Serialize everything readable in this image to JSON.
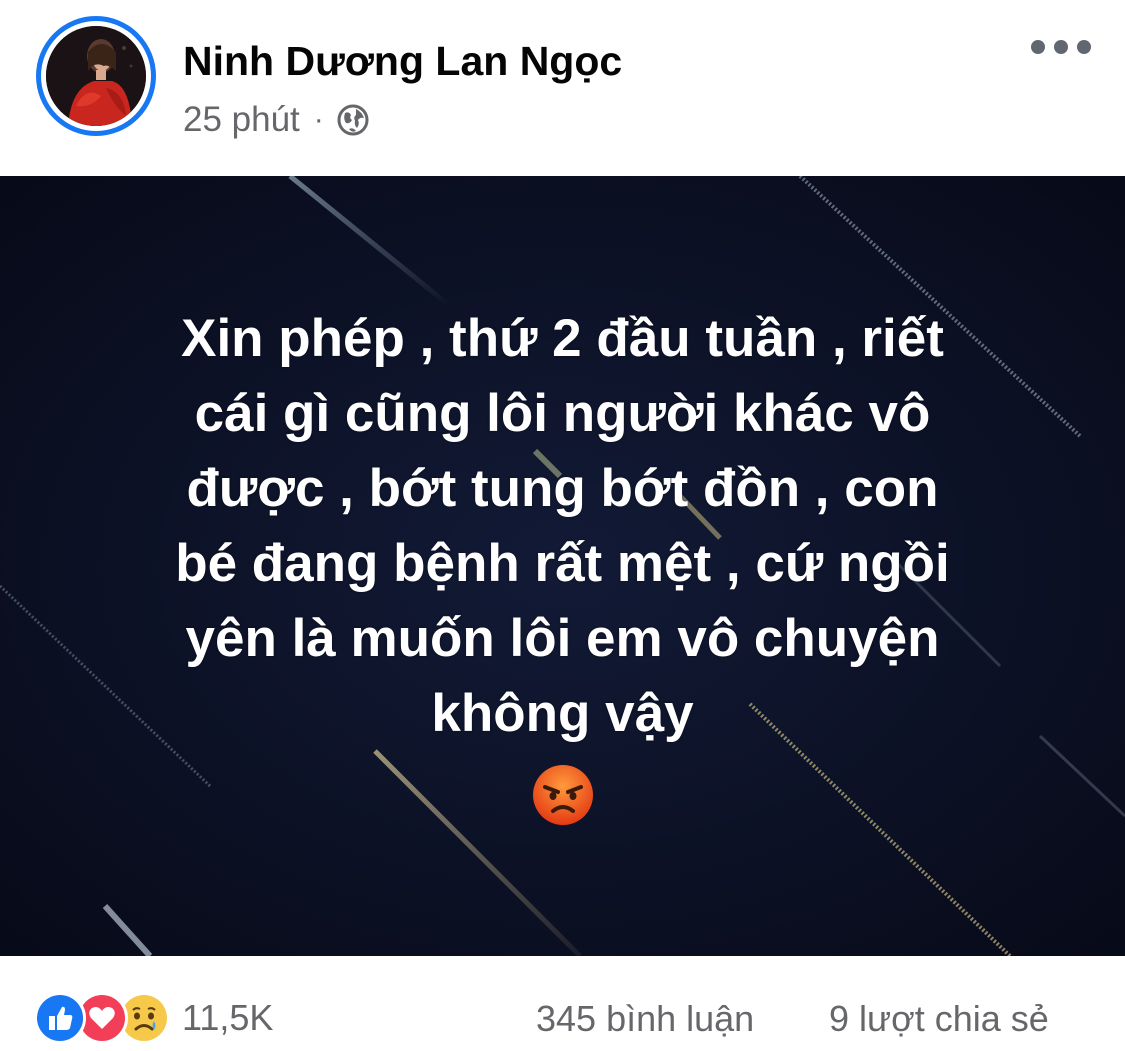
{
  "post": {
    "author_name": "Ninh Dương Lan Ngọc",
    "timestamp": "25 phút",
    "separator": "·",
    "privacy_icon": "globe-icon",
    "more_icon": "more-options-icon",
    "avatar_ring_color": "#1877f2",
    "image_text": "Xin phép , thứ 2 đầu tuần , riết\ncái gì cũng lôi người khác vô\nđược , bớt tung bớt đồn , con\nbé đang bệnh rất mệt , cứ ngồi\nyên là muốn lôi em vô chuyện\nkhông vậy",
    "image_emoji": "😡",
    "image_background": "#0b0f22"
  },
  "footer": {
    "reaction_icons": [
      "like-icon",
      "love-icon",
      "sad-icon"
    ],
    "reaction_count": "11,5K",
    "comments": "345 bình luận",
    "shares": "9 lượt chia sẻ"
  }
}
